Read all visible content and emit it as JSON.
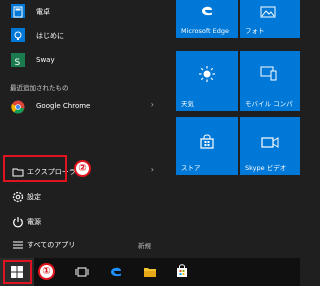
{
  "start_menu": {
    "apps": [
      {
        "label": "電卓",
        "icon": "calculator-icon"
      },
      {
        "label": "はじめに",
        "icon": "lightbulb-icon"
      },
      {
        "label": "Sway",
        "icon": "sway-icon"
      }
    ],
    "recent_header": "最近追加されたもの",
    "recent": [
      {
        "label": "Google Chrome",
        "icon": "chrome-icon"
      }
    ],
    "explorer": "エクスプローラー",
    "settings": "設定",
    "power": "電源",
    "all_apps": "すべてのアプリ",
    "new_label": "新規"
  },
  "tiles": [
    {
      "label": "Microsoft Edge",
      "icon": "edge-icon"
    },
    {
      "label": "フォト",
      "icon": "photos-icon"
    },
    {
      "label": "天気",
      "icon": "weather-sun-icon"
    },
    {
      "label": "モバイル コンパ",
      "icon": "mobile-companion-icon"
    },
    {
      "label": "ストア",
      "icon": "store-icon"
    },
    {
      "label": "Skype ビデオ",
      "icon": "skype-video-icon"
    }
  ],
  "annotations": {
    "step1": "①",
    "step2": "②"
  },
  "colors": {
    "tile": "#0078d7",
    "highlight": "#e0141e",
    "menu_bg": "#1f1f1f",
    "taskbar_bg": "#101010"
  }
}
